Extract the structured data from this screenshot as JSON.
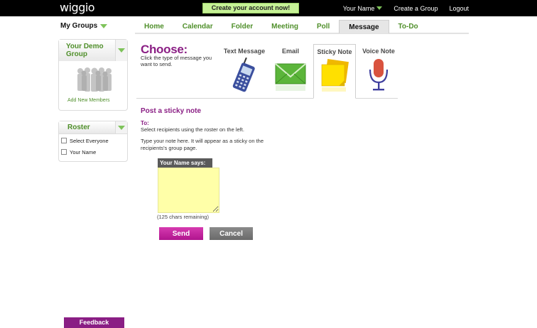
{
  "topbar": {
    "logo": "wiggio",
    "create_account": "Create your account now!",
    "user_name": "Your Name",
    "create_group": "Create a Group",
    "logout": "Logout"
  },
  "groups": {
    "label": "My Groups"
  },
  "nav": {
    "tabs": [
      {
        "label": "Home"
      },
      {
        "label": "Calendar"
      },
      {
        "label": "Folder"
      },
      {
        "label": "Meeting"
      },
      {
        "label": "Poll"
      },
      {
        "label": "Message",
        "active": true
      },
      {
        "label": "To-Do"
      }
    ]
  },
  "sidebar": {
    "group_name": "Your Demo Group",
    "add_members": "Add New Members",
    "roster_title": "Roster",
    "roster_items": [
      {
        "label": "Select Everyone"
      },
      {
        "label": "Your Name"
      }
    ]
  },
  "choose": {
    "title": "Choose:",
    "subtitle": "Click the type of message you want to send.",
    "types": [
      {
        "label": "Text Message",
        "icon": "cell-phone-icon"
      },
      {
        "label": "Email",
        "icon": "envelope-icon"
      },
      {
        "label": "Sticky Note",
        "icon": "sticky-note-icon",
        "selected": true
      },
      {
        "label": "Voice Note",
        "icon": "microphone-icon"
      }
    ]
  },
  "form": {
    "title": "Post a sticky note",
    "to_label": "To:",
    "to_desc": "Select recipients using the roster on the left.",
    "note_desc": "Type your note here. It will appear as a sticky on the recipients's group page.",
    "sticky_header": "Your Name says:",
    "chars_remaining": "(125 chars remaining)",
    "send": "Send",
    "cancel": "Cancel"
  },
  "feedback": "Feedback",
  "colors": {
    "brand_purple": "#8a1e84",
    "brand_green": "#4f8f2a",
    "send_magenta": "#c0209a",
    "sticky_yellow": "#ffffa8"
  }
}
